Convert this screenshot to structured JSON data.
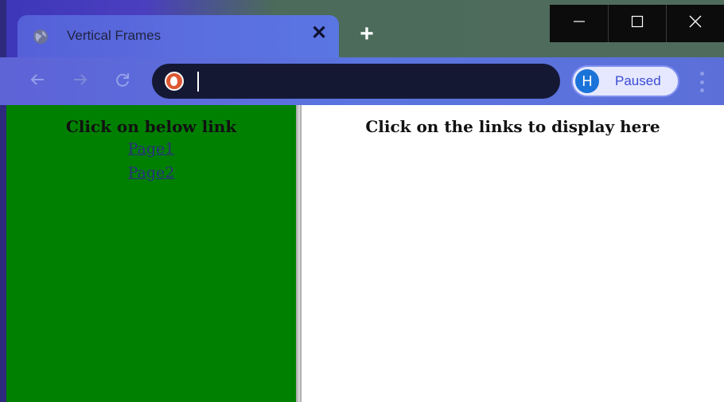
{
  "browser": {
    "tab_title": "Vertical Frames",
    "tab_close_symbol": "✕",
    "new_tab_symbol": "+",
    "profile_initial": "H",
    "profile_status": "Paused",
    "address_value": "",
    "accent_color": "#5a74e0"
  },
  "window_controls": {
    "minimize_icon": "minimize-icon",
    "maximize_icon": "maximize-icon",
    "close_icon": "close-icon"
  },
  "left_frame": {
    "heading": "Click on below link",
    "links": [
      "Page1",
      "Page2"
    ],
    "background_color": "#008000"
  },
  "right_frame": {
    "heading": "Click on the links to display here"
  }
}
